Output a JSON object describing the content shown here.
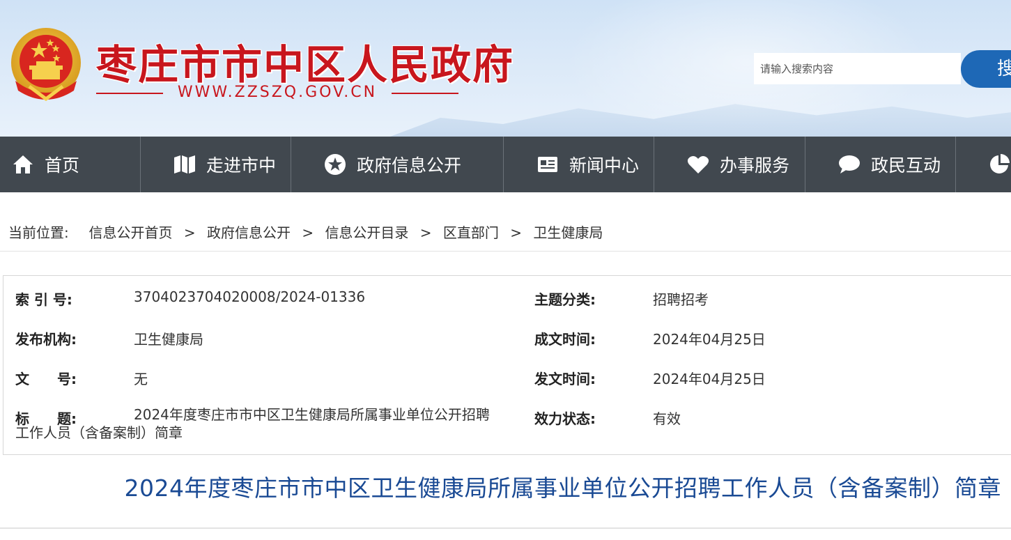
{
  "header": {
    "site_title": "枣庄市市中区人民政府",
    "site_url": "WWW.ZZSZQ.GOV.CN",
    "search_placeholder": "请输入搜索内容",
    "search_button_label": "搜"
  },
  "nav": {
    "items": [
      {
        "label": "首页",
        "icon": "home-icon"
      },
      {
        "label": "走进市中",
        "icon": "map-icon"
      },
      {
        "label": "政府信息公开",
        "icon": "star-icon"
      },
      {
        "label": "新闻中心",
        "icon": "news-icon"
      },
      {
        "label": "办事服务",
        "icon": "heart-icon"
      },
      {
        "label": "政民互动",
        "icon": "chat-icon"
      },
      {
        "label": "",
        "icon": "chart-icon"
      }
    ]
  },
  "breadcrumb": {
    "prefix": "当前位置:",
    "items": [
      "信息公开首页",
      "政府信息公开",
      "信息公开目录",
      "区直部门",
      "卫生健康局"
    ],
    "separator": ">"
  },
  "info": {
    "index_label": "索 引 号:",
    "index_value": "3704023704020008/2024-01336",
    "topic_label": "主题分类:",
    "topic_value": "招聘招考",
    "publisher_label": "发布机构:",
    "publisher_value": "卫生健康局",
    "created_label": "成文时间:",
    "created_value": "2024年04月25日",
    "doc_no_label": "文　　号:",
    "doc_no_value": "无",
    "issued_label": "发文时间:",
    "issued_value": "2024年04月25日",
    "title_label": "标　　题:",
    "title_value": "2024年度枣庄市市中区卫生健康局所属事业单位公开招聘工作人员（含备案制）简章",
    "status_label": "效力状态:",
    "status_value": "有效"
  },
  "article": {
    "title": "2024年度枣庄市市中区卫生健康局所属事业单位公开招聘工作人员（含备案制）简章"
  },
  "colors": {
    "brand_red": "#c8161d",
    "nav_bg": "#41484f",
    "search_blue": "#1e68b6",
    "title_blue": "#1a4a94"
  }
}
